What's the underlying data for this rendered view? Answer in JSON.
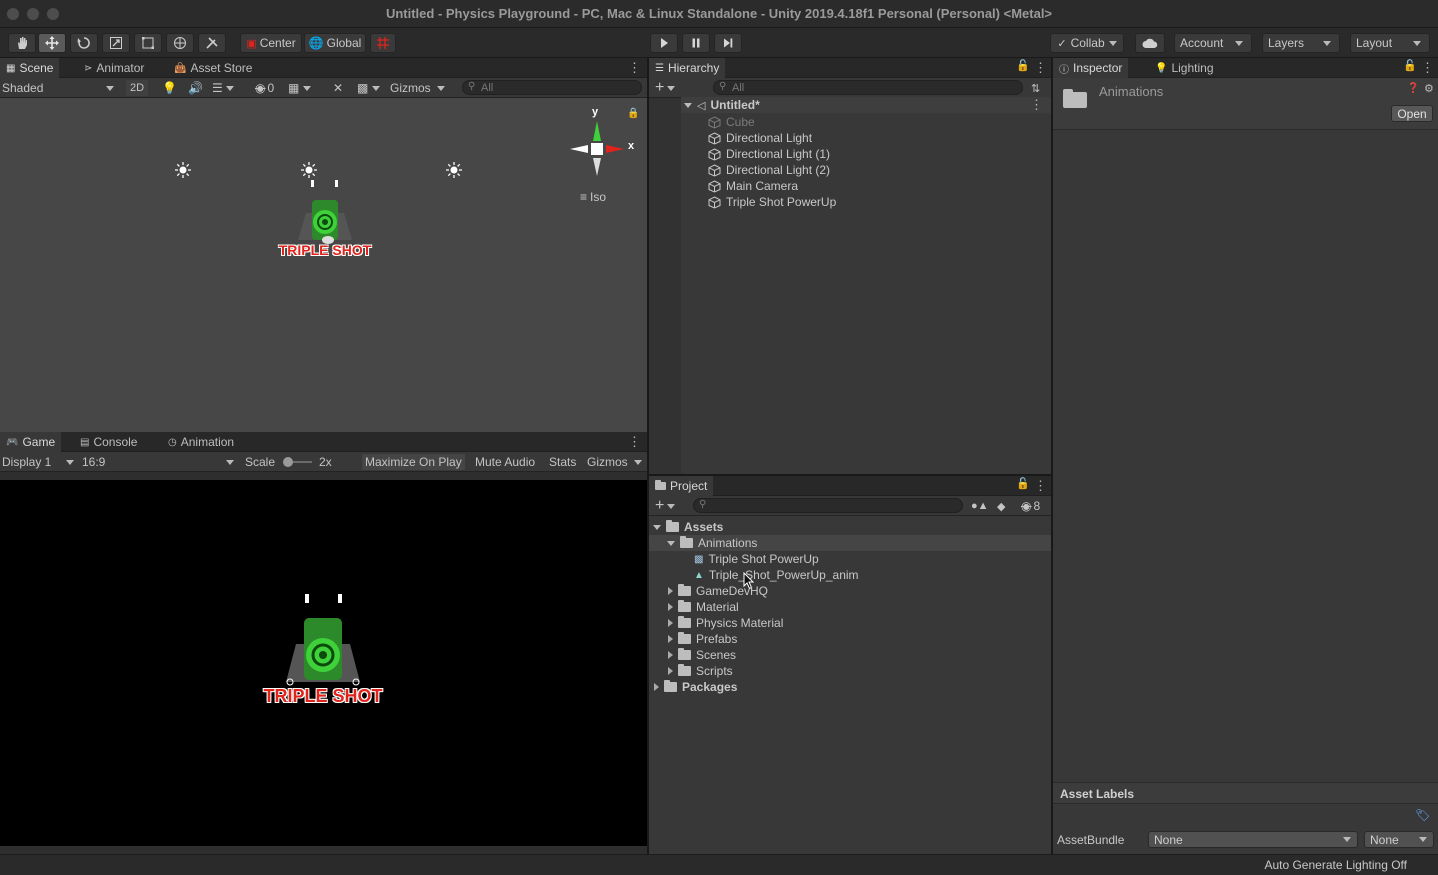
{
  "window": {
    "title": "Untitled - Physics Playground - PC, Mac & Linux Standalone - Unity 2019.4.18f1 Personal (Personal) <Metal>"
  },
  "toolbar": {
    "pivot": "Center",
    "space": "Global",
    "collab": "Collab",
    "account": "Account",
    "layers": "Layers",
    "layout": "Layout"
  },
  "scene": {
    "tabs": [
      "Scene",
      "Animator",
      "Asset Store"
    ],
    "draw_mode": "Shaded",
    "mode_2d": "2D",
    "hidden_count": "0",
    "gizmos": "Gizmos",
    "search_placeholder": "All",
    "axis_y": "y",
    "axis_x": "x",
    "projection": "Iso",
    "sprite_text": "TRIPLE SHOT"
  },
  "game": {
    "tabs": [
      "Game",
      "Console",
      "Animation"
    ],
    "display": "Display 1",
    "aspect": "16:9",
    "scale_label": "Scale",
    "scale_value": "2x",
    "maximize": "Maximize On Play",
    "mute": "Mute Audio",
    "stats": "Stats",
    "gizmos": "Gizmos",
    "sprite_text": "TRIPLE SHOT"
  },
  "hierarchy": {
    "tab": "Hierarchy",
    "search_placeholder": "All",
    "scene_name": "Untitled*",
    "items": [
      "Cube",
      "Directional Light",
      "Directional Light (1)",
      "Directional Light (2)",
      "Main Camera",
      "Triple Shot PowerUp"
    ]
  },
  "project": {
    "tab": "Project",
    "hidden_count": "8",
    "assets_root": "Assets",
    "animations_folder": "Animations",
    "animation_items": [
      "Triple Shot PowerUp",
      "Triple_Shot_PowerUp_anim"
    ],
    "folders": [
      "GameDevHQ",
      "Material",
      "Physics Material",
      "Prefabs",
      "Scenes",
      "Scripts"
    ],
    "packages": "Packages"
  },
  "inspector": {
    "tabs": [
      "Inspector",
      "Lighting"
    ],
    "asset_name": "Animations",
    "open_button": "Open",
    "asset_labels": "Asset Labels",
    "assetbundle_label": "AssetBundle",
    "assetbundle_value": "None",
    "variant_value": "None"
  },
  "status": {
    "lighting": "Auto Generate Lighting Off"
  },
  "colors": {
    "accent_red": "#e0241c",
    "accent_green": "#3fd13a",
    "selected_row": "#454545"
  }
}
